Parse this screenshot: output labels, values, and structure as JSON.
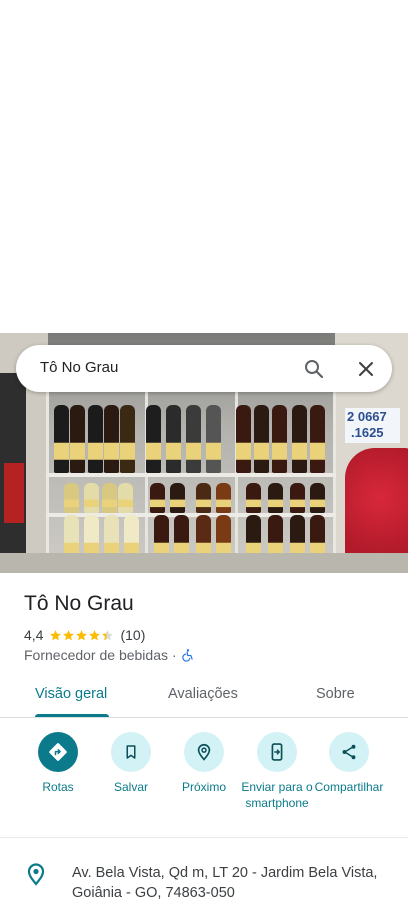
{
  "search": {
    "query": "Tô No Grau"
  },
  "place": {
    "name": "Tô No Grau",
    "rating": "4,4",
    "rating_value": 4.4,
    "rating_max": 5,
    "review_count": "(10)",
    "category": "Fornecedor de bebidas",
    "separator": "·",
    "accessibility_icon": "wheelchair-icon"
  },
  "hero_sign": {
    "line1": "2 0667",
    "line2": ".1625"
  },
  "tabs": [
    {
      "label": "Visão geral",
      "active": true
    },
    {
      "label": "Avaliações",
      "active": false
    },
    {
      "label": "Sobre",
      "active": false
    }
  ],
  "actions": [
    {
      "label": "Rotas",
      "icon": "directions-icon"
    },
    {
      "label": "Salvar",
      "icon": "bookmark-icon"
    },
    {
      "label": "Próximo",
      "icon": "nearby-icon"
    },
    {
      "label": "Enviar para o smartphone",
      "icon": "send-to-phone-icon"
    },
    {
      "label": "Compartilhar",
      "icon": "share-icon"
    }
  ],
  "address": {
    "text": "Av. Bela Vista, Qd m, LT 20 - Jardim Bela Vista, Goiânia - GO, 74863-050",
    "icon": "location-pin-icon"
  },
  "colors": {
    "accent": "#0b7a8a",
    "accent_light": "#d2f2f6",
    "star": "#fbbc04",
    "accessibility": "#1a73e8"
  }
}
